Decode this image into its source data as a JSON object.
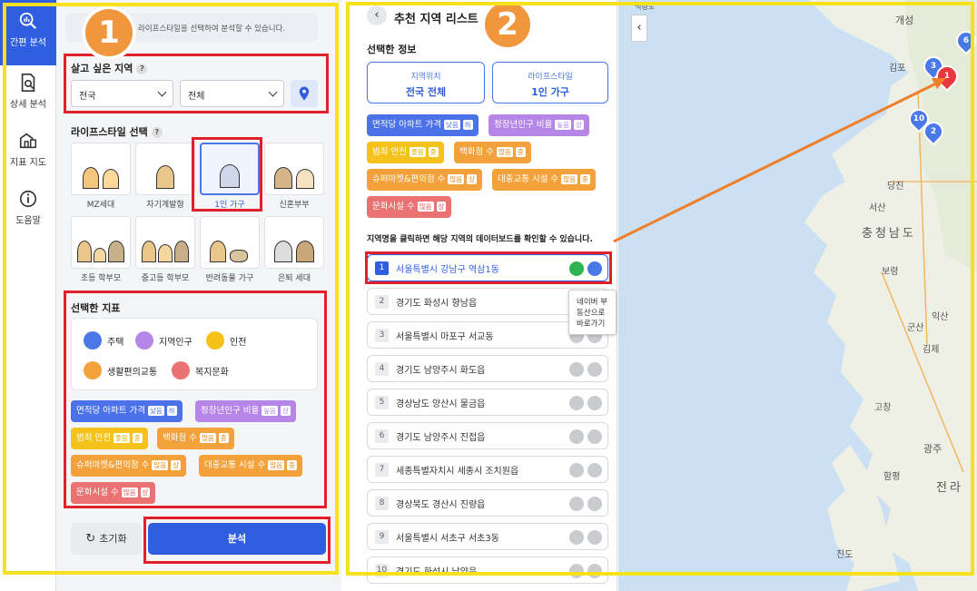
{
  "left": {
    "nav": [
      {
        "label": "간편 분석",
        "icon": "chart-search-icon"
      },
      {
        "label": "상세 분석",
        "icon": "document-search-icon"
      },
      {
        "label": "지표 지도",
        "icon": "map-building-icon"
      },
      {
        "label": "도움말",
        "icon": "info-icon"
      }
    ],
    "notice": "라이프스타일을 선택하여 분석할 수 있습니다.",
    "region_title": "살고 싶은 지역",
    "region_select1": "전국",
    "region_select2": "전체",
    "lifestyle_title": "라이프스타일 선택",
    "lifestyles": [
      "MZ세대",
      "자기계발형",
      "1인 가구",
      "신혼부부",
      "초등 학부모",
      "중고등 학부모",
      "반려동물 가구",
      "은퇴 세대"
    ],
    "indicators_title": "선택한 지표",
    "indicators": [
      "주택",
      "지역인구",
      "인전",
      "생활편의교통",
      "복지문화"
    ],
    "reset_label": "초기화",
    "analyze_label": "분석",
    "badge": "1"
  },
  "chips": [
    {
      "text": "면적당 아파트 가격",
      "tag1": "낮음",
      "tag2": "하"
    },
    {
      "text": "청장년인구 비율",
      "tag1": "높음",
      "tag2": "상"
    },
    {
      "text": "범죄 안전",
      "tag1": "좋음",
      "tag2": "중"
    },
    {
      "text": "백화점 수",
      "tag1": "많음",
      "tag2": "중"
    },
    {
      "text": "슈퍼마켓&편의점 수",
      "tag1": "많음",
      "tag2": "상"
    },
    {
      "text": "대중교통 시설 수",
      "tag1": "많음",
      "tag2": "중"
    },
    {
      "text": "문화시설 수",
      "tag1": "많음",
      "tag2": "상"
    }
  ],
  "right": {
    "title": "추천 지역 리스트",
    "badge": "2",
    "selected_info": "선택한 정보",
    "loc_label": "지역위치",
    "loc_value": "전국 전체",
    "ls_label": "라이프스타일",
    "ls_value": "1인 가구",
    "hint": "지역명을 클릭하면 해당 지역의 데이터보드를 확인할 수 있습니다.",
    "tooltip": "네이버 부동산으로 바로가기",
    "rows": [
      {
        "n": "1",
        "name": "서울특별시 강남구 역삼1동"
      },
      {
        "n": "2",
        "name": "경기도 화성시 향남읍"
      },
      {
        "n": "3",
        "name": "서울특별시 마포구 서교동"
      },
      {
        "n": "4",
        "name": "경기도 남양주시 화도읍"
      },
      {
        "n": "5",
        "name": "경상남도 양산시 물금읍"
      },
      {
        "n": "6",
        "name": "경기도 남양주시 진접읍"
      },
      {
        "n": "7",
        "name": "세종특별자치시 세종시 조치원읍"
      },
      {
        "n": "8",
        "name": "경상북도 경산시 진량읍"
      },
      {
        "n": "9",
        "name": "서울특별시 서초구 서초3동"
      },
      {
        "n": "10",
        "name": "경기도 화성시 남양읍"
      }
    ]
  },
  "map": {
    "labels": [
      "개성",
      "백령도",
      "김포",
      "당진",
      "서산",
      "충청남도",
      "보령",
      "군산",
      "익산",
      "김제",
      "광주",
      "전라",
      "진도",
      "고창",
      "함평"
    ],
    "pins": [
      "1",
      "2",
      "3",
      "6",
      "10"
    ]
  }
}
